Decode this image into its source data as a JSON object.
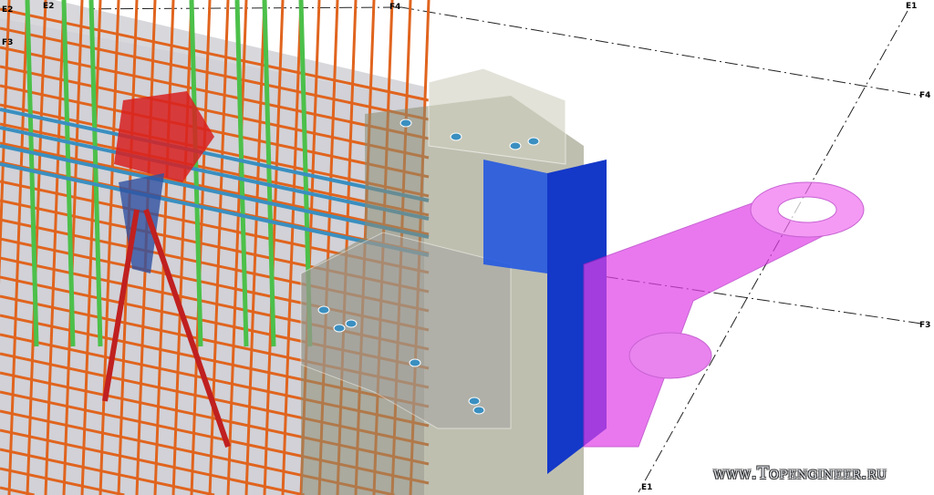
{
  "grid_labels": {
    "e2_left": "E2",
    "e2_top": "E2",
    "f3_left": "F3",
    "f4_top": "F4",
    "e1_top": "E1",
    "f4_right": "F4",
    "f3_right": "F3",
    "e1_bottom": "E1"
  },
  "watermark": "www.Topengineer.ru",
  "colors": {
    "rebar_orange": "#e0641e",
    "rebar_green": "#4cc04a",
    "pipe_blue": "#3a8fc0",
    "duct_magenta": "#e040e8",
    "column_blue": "#1030c0",
    "red_block": "#d82020",
    "wall_gray": "#c8c8cc"
  }
}
